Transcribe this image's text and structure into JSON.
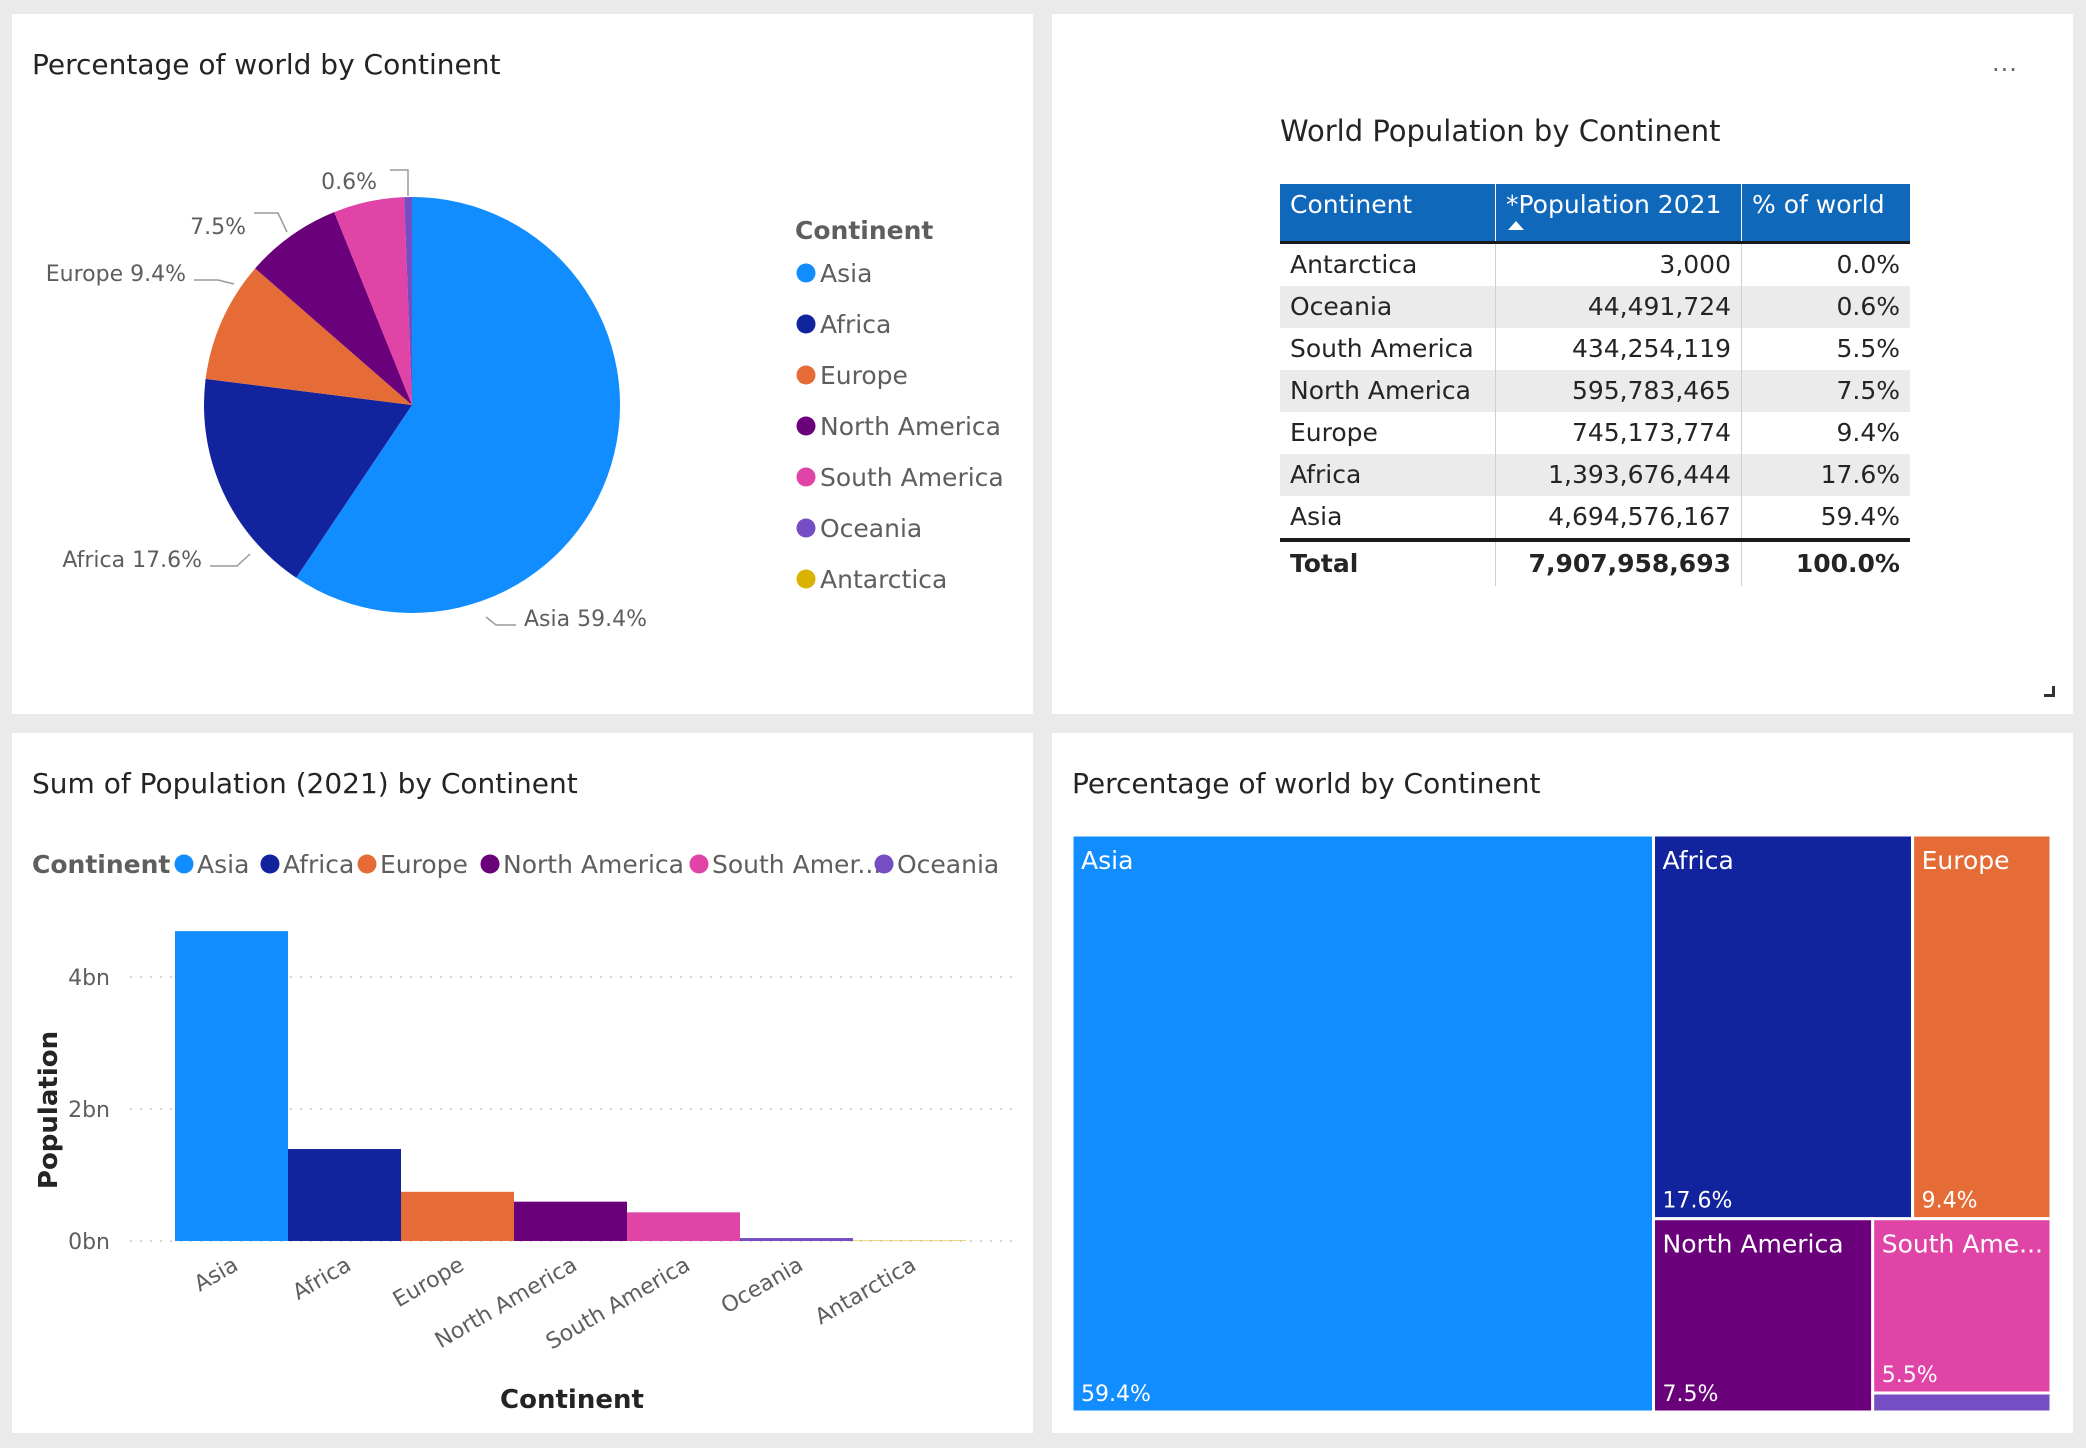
{
  "colors": {
    "Asia": "#118dff",
    "Africa": "#12239e",
    "Europe": "#e66c37",
    "North America": "#6b007b",
    "South America": "#e044a7",
    "Oceania": "#744ec2",
    "Antarctica": "#d9b300"
  },
  "pie_panel": {
    "title": "Percentage of world by Continent",
    "legend_title": "Continent",
    "legend_items": [
      "Asia",
      "Africa",
      "Europe",
      "North America",
      "South America",
      "Oceania",
      "Antarctica"
    ],
    "slice_labels": {
      "Asia": "Asia 59.4%",
      "Africa": "Africa 17.6%",
      "Europe": "Europe 9.4%",
      "North America": "7.5%",
      "South America": "",
      "Oceania": "0.6%",
      "Antarctica": ""
    }
  },
  "table_panel": {
    "title": "World Population by Continent",
    "more_icon": "ellipsis-icon",
    "columns": [
      "Continent",
      "*Population 2021",
      "% of world"
    ],
    "sort_icon": "sort-ascending-icon",
    "rows": [
      [
        "Antarctica",
        "3,000",
        "0.0%"
      ],
      [
        "Oceania",
        "44,491,724",
        "0.6%"
      ],
      [
        "South America",
        "434,254,119",
        "5.5%"
      ],
      [
        "North America",
        "595,783,465",
        "7.5%"
      ],
      [
        "Europe",
        "745,173,774",
        "9.4%"
      ],
      [
        "Africa",
        "1,393,676,444",
        "17.6%"
      ],
      [
        "Asia",
        "4,694,576,167",
        "59.4%"
      ]
    ],
    "total": [
      "Total",
      "7,907,958,693",
      "100.0%"
    ]
  },
  "bar_panel": {
    "title": "Sum of Population (2021) by Continent",
    "legend_title": "Continent",
    "legend_items": [
      "Asia",
      "Africa",
      "Europe",
      "North America",
      "South Amer...",
      "Oceania"
    ],
    "legend_keys": [
      "Asia",
      "Africa",
      "Europe",
      "North America",
      "South America",
      "Oceania"
    ]
  },
  "treemap_panel": {
    "title": "Percentage of world by Continent",
    "labels": {
      "Asia": [
        "Asia",
        "59.4%"
      ],
      "Africa": [
        "Africa",
        "17.6%"
      ],
      "Europe": [
        "Europe",
        "9.4%"
      ],
      "North America": [
        "North America",
        "7.5%"
      ],
      "South America": [
        "South Ame...",
        "5.5%"
      ],
      "Oceania": [
        "",
        ""
      ],
      "Antarctica": [
        "",
        ""
      ]
    }
  },
  "chart_data": [
    {
      "type": "pie",
      "title": "Percentage of world by Continent",
      "legend_title": "Continent",
      "legend_position": "right",
      "categories": [
        "Asia",
        "Africa",
        "Europe",
        "North America",
        "South America",
        "Oceania",
        "Antarctica"
      ],
      "values": [
        59.4,
        17.6,
        9.4,
        7.5,
        5.5,
        0.6,
        0.0
      ]
    },
    {
      "type": "table",
      "title": "World Population by Continent",
      "columns": [
        "Continent",
        "*Population 2021",
        "% of world"
      ],
      "categories": [
        "Antarctica",
        "Oceania",
        "South America",
        "North America",
        "Europe",
        "Africa",
        "Asia"
      ],
      "population": [
        3000,
        44491724,
        434254119,
        595783465,
        745173774,
        1393676444,
        4694576167
      ],
      "percent": [
        0.0,
        0.6,
        5.5,
        7.5,
        9.4,
        17.6,
        59.4
      ],
      "total": 7907958693
    },
    {
      "type": "bar",
      "title": "Sum of Population (2021) by Continent",
      "xlabel": "Continent",
      "ylabel": "Population",
      "categories": [
        "Asia",
        "Africa",
        "Europe",
        "North America",
        "South America",
        "Oceania",
        "Antarctica"
      ],
      "values": [
        4694576167,
        1393676444,
        745173774,
        595783465,
        434254119,
        44491724,
        3000
      ],
      "yticks": [
        0,
        2000000000,
        4000000000
      ],
      "ytick_labels": [
        "0bn",
        "2bn",
        "4bn"
      ],
      "ylim": [
        0,
        5000000000
      ],
      "legend_position": "top",
      "grid": true
    },
    {
      "type": "treemap",
      "title": "Percentage of world by Continent",
      "categories": [
        "Asia",
        "Africa",
        "Europe",
        "North America",
        "South America",
        "Oceania",
        "Antarctica"
      ],
      "values": [
        59.4,
        17.6,
        9.4,
        7.5,
        5.5,
        0.6,
        0.0
      ]
    }
  ]
}
